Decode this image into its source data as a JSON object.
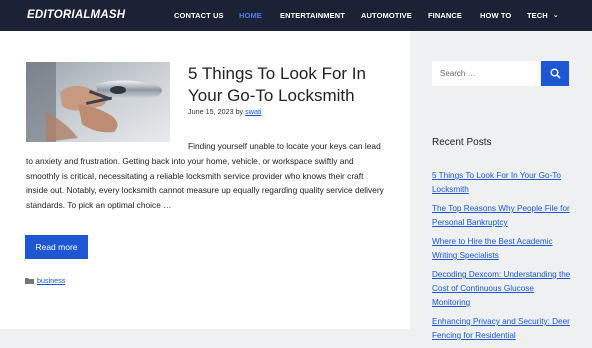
{
  "header": {
    "brand": "EDITORIALMASH",
    "nav": [
      {
        "label": "CONTACT US"
      },
      {
        "label": "HOME"
      },
      {
        "label": "ENTERTAINMENT"
      },
      {
        "label": "AUTOMOTIVE"
      },
      {
        "label": "FINANCE"
      },
      {
        "label": "HOW TO"
      },
      {
        "label": "TECH"
      }
    ]
  },
  "post": {
    "title": "5 Things To Look For In Your Go-To Locksmith",
    "date": "June 15, 2023",
    "by": "by",
    "author": "swati",
    "excerpt": "Finding yourself unable to locate your keys can lead to anxiety and frustration. Getting back into your home, vehicle, or workspace swiftly and smoothly is critical, necessitating a reliable locksmith service provider who knows their craft inside out. Notably, every locksmith cannot measure up equally regarding quality service delivery standards. To pick an optimal choice …",
    "read_more": "Read more",
    "category": "business",
    "thumbnail_icon": "locksmith-photo"
  },
  "sidebar": {
    "search_placeholder": "Search …",
    "recent_title": "Recent Posts",
    "recent": [
      "5 Things To Look For In Your Go-To Locksmith",
      "The Top Reasons Why People File for Personal Bankruptcy",
      "Where to Hire the Best Academic Writing Specialists",
      "Decoding Dexcom: Understanding the Cost of Continuous Glucose Monitoring",
      "Enhancing Privacy and Security: Deer Fencing for Residential"
    ]
  },
  "colors": {
    "topbar": "#1b2235",
    "accent": "#1e57d4",
    "active_nav": "#4f7df0",
    "link": "#1a56db"
  }
}
